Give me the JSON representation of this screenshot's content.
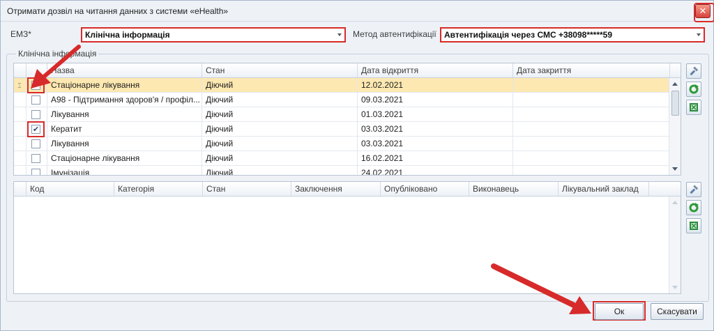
{
  "window": {
    "title": "Отримати дозвіл на читання данних з системи «eHealth»"
  },
  "form": {
    "emz_label": "ЕМЗ*",
    "emz_value": "Клінічна інформація",
    "auth_label": "Метод автентифікації",
    "auth_value": "Автентифікація через СМС  +38098*****59"
  },
  "group": {
    "legend": "Клінічна інформація"
  },
  "top_grid": {
    "columns": [
      "Назва",
      "Стан",
      "Дата відкриття",
      "Дата закриття"
    ],
    "rows": [
      {
        "checked": true,
        "name": "Стаціонарне лікування",
        "state": "Діючий",
        "opened": "12.02.2021",
        "closed": "",
        "selected": true
      },
      {
        "checked": false,
        "name": "A98 - Підтримання здоров'я / профіл...",
        "state": "Діючий",
        "opened": "09.03.2021",
        "closed": ""
      },
      {
        "checked": false,
        "name": "Лікування",
        "state": "Діючий",
        "opened": "01.03.2021",
        "closed": ""
      },
      {
        "checked": true,
        "name": "Кератит",
        "state": "Діючий",
        "opened": "03.03.2021",
        "closed": ""
      },
      {
        "checked": false,
        "name": "Лікування",
        "state": "Діючий",
        "opened": "03.03.2021",
        "closed": ""
      },
      {
        "checked": false,
        "name": "Стаціонарне лікування",
        "state": "Діючий",
        "opened": "16.02.2021",
        "closed": ""
      },
      {
        "checked": false,
        "name": "Імунізація",
        "state": "Діючий",
        "opened": "24.02.2021",
        "closed": ""
      }
    ]
  },
  "bottom_grid": {
    "columns": [
      "Код",
      "Категорія",
      "Стан",
      "Заключення",
      "Опубліковано",
      "Виконавець",
      "Лікувальний заклад"
    ]
  },
  "buttons": {
    "ok": "Ок",
    "cancel": "Скасувати"
  },
  "icons": [
    "close-icon",
    "tools-icon",
    "refresh-icon",
    "excel-export-icon",
    "chevron-down-icon",
    "scroll-up-icon",
    "scroll-down-icon",
    "row-cursor-icon",
    "checkmark-icon"
  ],
  "colors": {
    "highlight_red": "#d72a2a",
    "selected_row": "#fde8b1",
    "window_bg": "#eef2f7"
  }
}
